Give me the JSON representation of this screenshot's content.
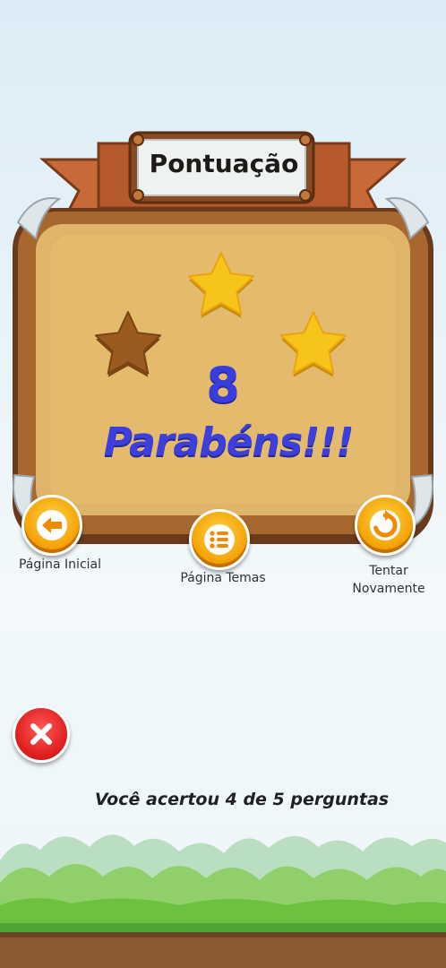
{
  "title": "Pontuação",
  "stars": {
    "earned": 2,
    "total": 3
  },
  "score": "8",
  "message": "Parabéns!!!",
  "buttons": {
    "home": {
      "label": "Página Inicial",
      "icon": "arrow-left-icon"
    },
    "themes": {
      "label": "Página Temas",
      "icon": "list-icon"
    },
    "retry": {
      "label_line1": "Tentar",
      "label_line2": "Novamente",
      "icon": "refresh-icon"
    },
    "close": {
      "icon": "close-icon"
    }
  },
  "result_text": "Você acertou  4 de 5 perguntas",
  "colors": {
    "score_blue": "#3a3ddb",
    "star_gold": "#f7c419",
    "star_empty": "#9b5a20",
    "button_orange": "#f5a60a",
    "close_red": "#e01f1f"
  }
}
